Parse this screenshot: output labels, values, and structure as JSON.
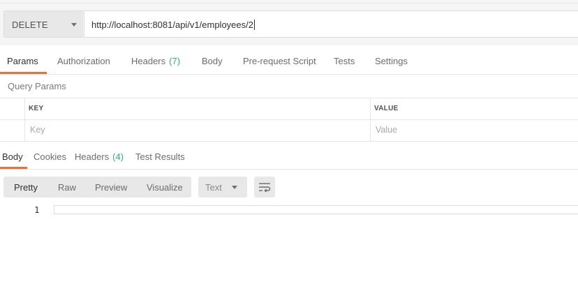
{
  "request": {
    "method": "DELETE",
    "url": "http://localhost:8081/api/v1/employees/2"
  },
  "request_tabs": [
    {
      "label": "Params"
    },
    {
      "label": "Authorization"
    },
    {
      "label": "Headers",
      "count": "(7)"
    },
    {
      "label": "Body"
    },
    {
      "label": "Pre-request Script"
    },
    {
      "label": "Tests"
    },
    {
      "label": "Settings"
    }
  ],
  "query_params": {
    "title": "Query Params",
    "headers": {
      "key": "KEY",
      "value": "VALUE"
    },
    "placeholders": {
      "key": "Key",
      "value": "Value"
    }
  },
  "response_tabs": [
    {
      "label": "Body"
    },
    {
      "label": "Cookies"
    },
    {
      "label": "Headers",
      "count": "(4)"
    },
    {
      "label": "Test Results"
    }
  ],
  "response_toolbar": {
    "formats": [
      "Pretty",
      "Raw",
      "Preview",
      "Visualize"
    ],
    "language": "Text"
  },
  "editor": {
    "line_number": "1"
  },
  "colors": {
    "accent": "#f26b3a",
    "count_green": "#26b47f"
  }
}
